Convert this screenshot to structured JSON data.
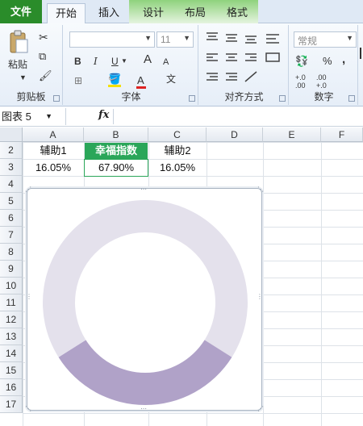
{
  "tabs": [
    "文件",
    "开始",
    "插入",
    "设计",
    "布局",
    "格式"
  ],
  "ribbon": {
    "clipboard": {
      "paste": "粘贴",
      "label": "剪贴板"
    },
    "font": {
      "name": "",
      "size": "11",
      "bold": "B",
      "italic": "I",
      "underline": "U",
      "grow": "A",
      "shrink": "A",
      "label": "字体"
    },
    "alignment": {
      "label": "对齐方式"
    },
    "number": {
      "format": "常规",
      "percent": "%",
      "comma": ",",
      "inc_dec": "+.0\n.00",
      "dec_dec": ".00\n+.0",
      "label": "数字"
    }
  },
  "formula_bar": {
    "name_box": "图表 5",
    "fx": "fx",
    "formula": ""
  },
  "columns": [
    "A",
    "B",
    "C",
    "D",
    "E",
    "F"
  ],
  "rows": [
    "2",
    "3",
    "4",
    "5",
    "6",
    "7",
    "8",
    "9",
    "10",
    "11",
    "12",
    "13",
    "14",
    "15",
    "16",
    "17"
  ],
  "cells": {
    "row2": [
      "辅助1",
      "幸福指数",
      "辅助2"
    ],
    "row3": [
      "16.05%",
      "67.90%",
      "16.05%"
    ]
  },
  "colors": {
    "accent": "#2aa659",
    "slice_light": "#e4e1ec",
    "slice_dark": "#b0a2c8"
  },
  "chart_data": {
    "type": "pie",
    "title": "",
    "donut": true,
    "categories": [
      "辅助1",
      "幸福指数",
      "辅助2"
    ],
    "values": [
      16.05,
      67.9,
      16.05
    ],
    "colors": [
      "#b0a2c8",
      "#e4e1ec",
      "#b0a2c8"
    ]
  }
}
